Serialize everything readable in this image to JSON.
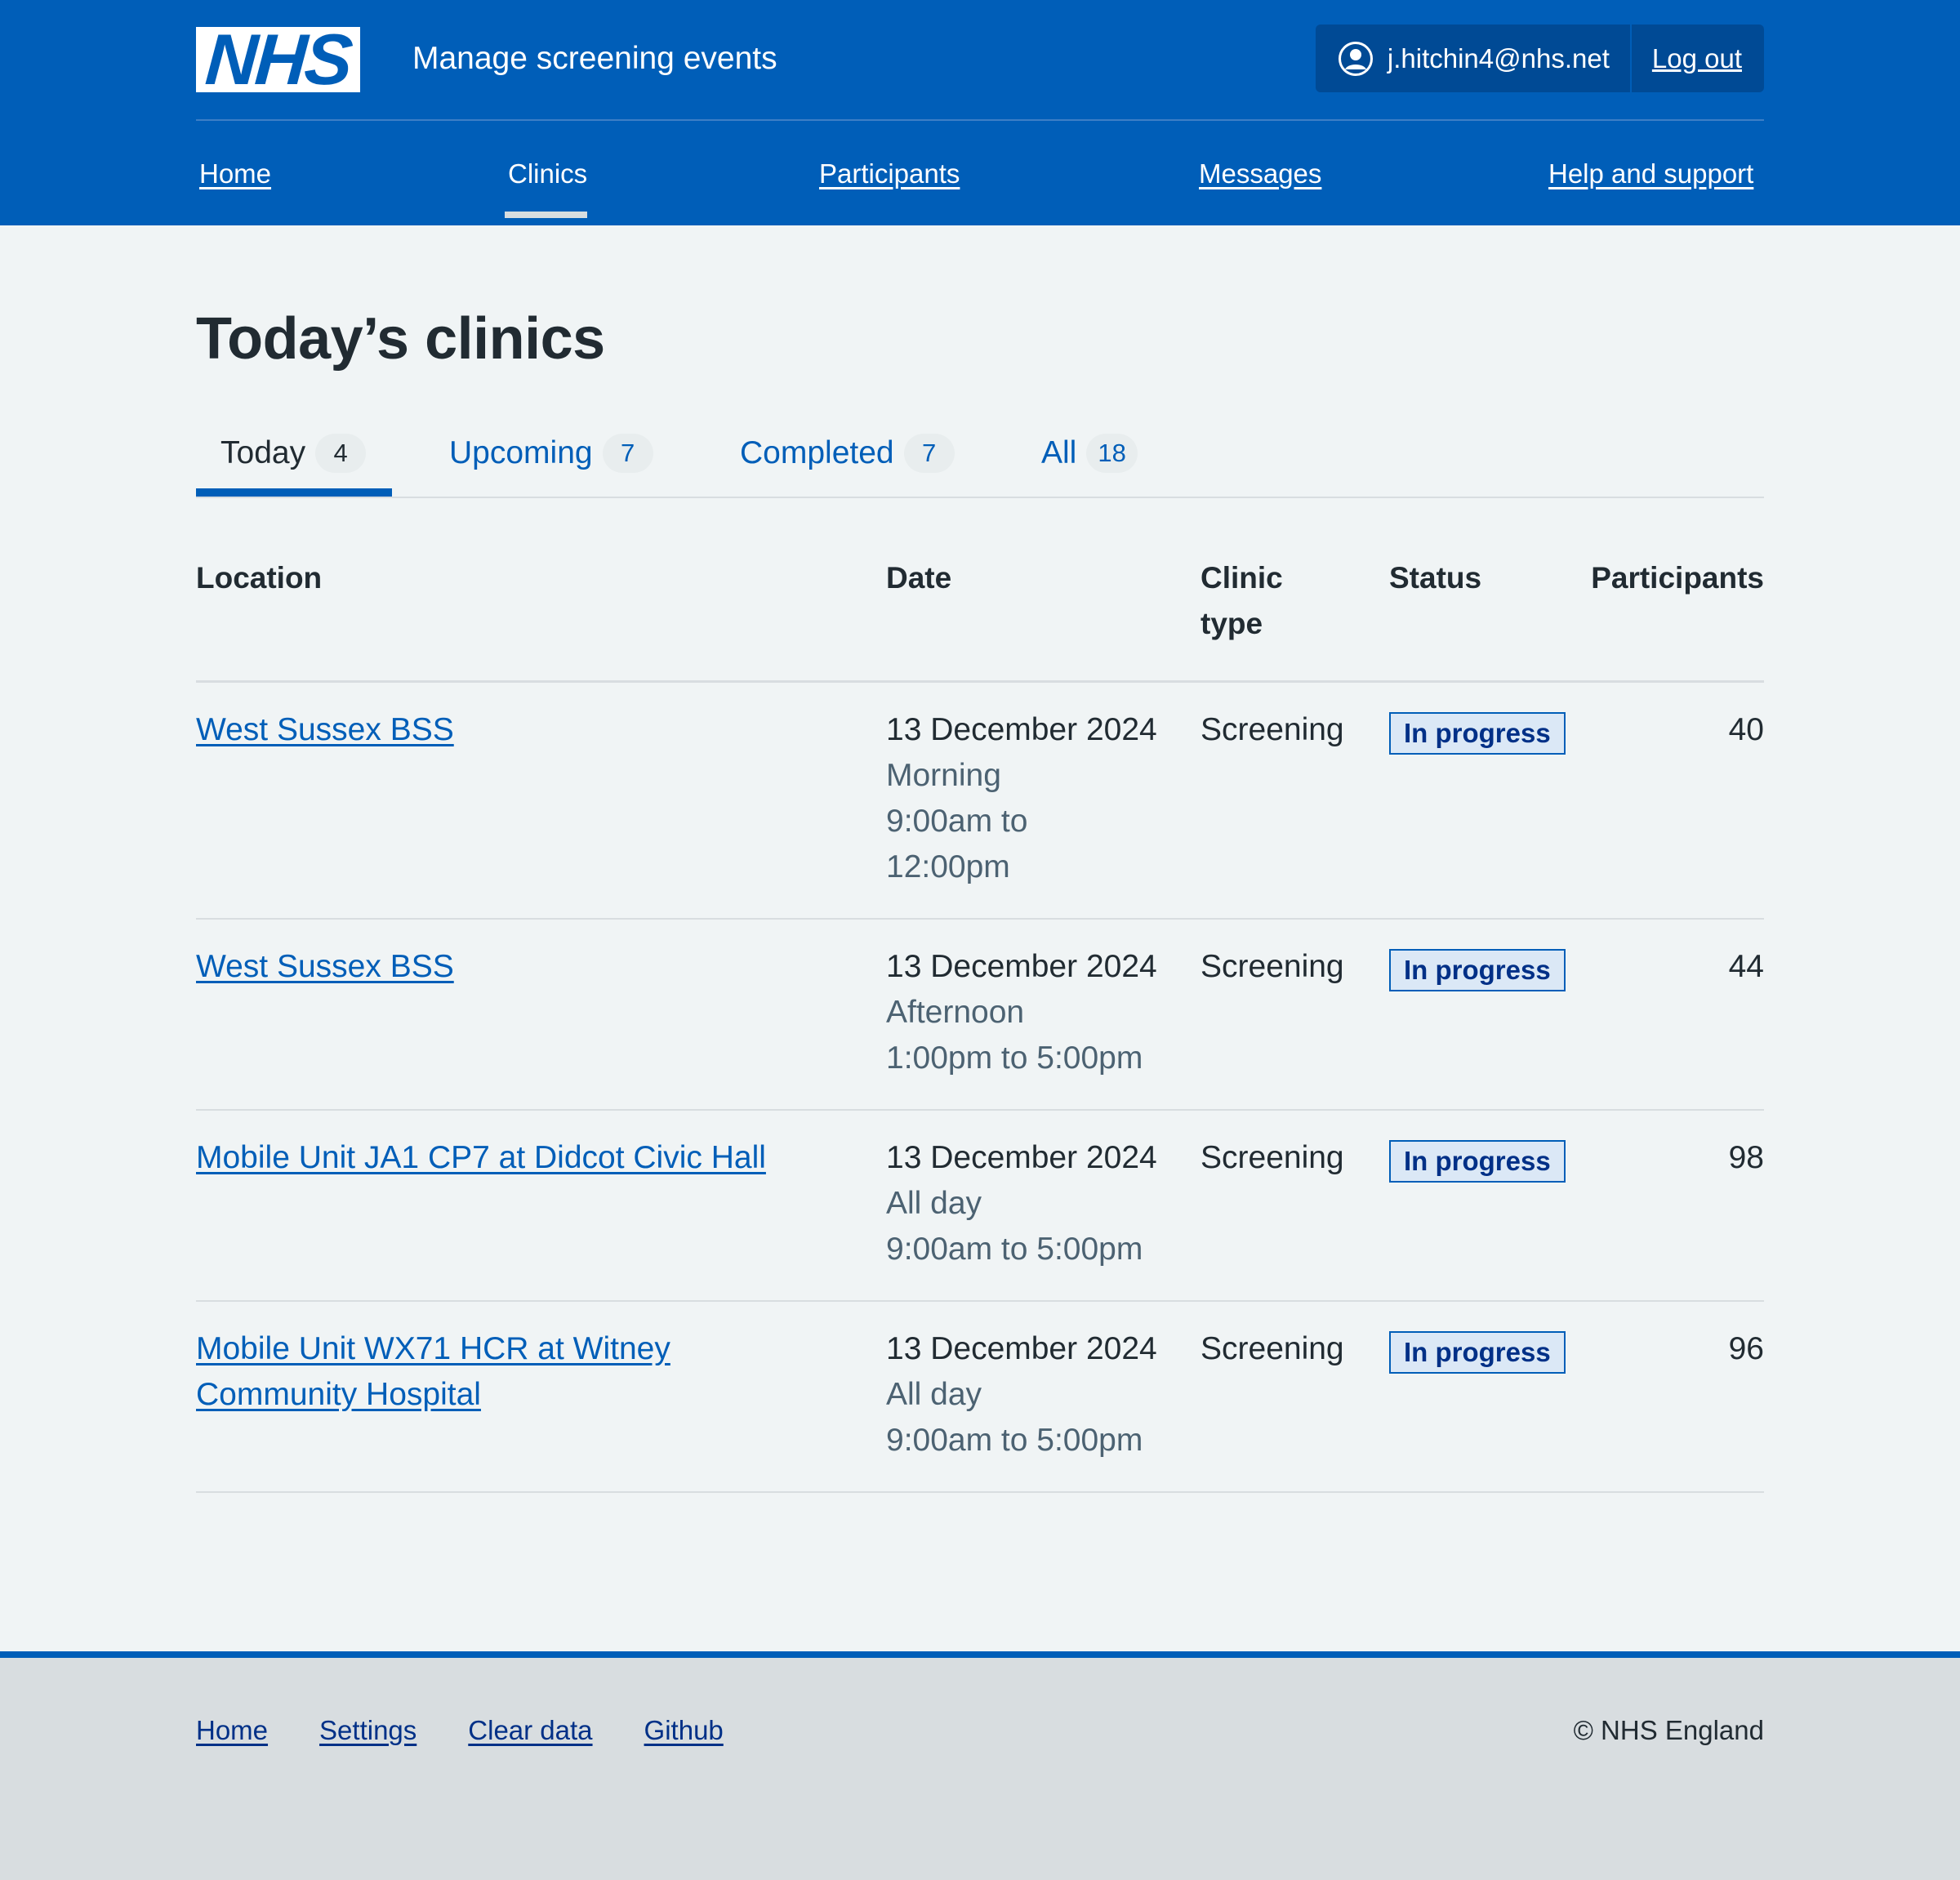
{
  "header": {
    "logo_text": "NHS",
    "service_name": "Manage screening events",
    "account_email": "j.hitchin4@nhs.net",
    "logout_label": "Log out",
    "brand_color": "#005eb8"
  },
  "nav": {
    "items": [
      {
        "label": "Home"
      },
      {
        "label": "Clinics",
        "current": true
      },
      {
        "label": "Participants"
      },
      {
        "label": "Messages"
      },
      {
        "label": "Help and support"
      }
    ]
  },
  "page": {
    "title": "Today’s clinics"
  },
  "tabs": [
    {
      "label": "Today",
      "count": "4",
      "selected": true
    },
    {
      "label": "Upcoming",
      "count": "7"
    },
    {
      "label": "Completed",
      "count": "7"
    },
    {
      "label": "All",
      "count": "18"
    }
  ],
  "table": {
    "headers": {
      "location": "Location",
      "date": "Date",
      "clinic_type_1": "Clinic",
      "clinic_type_2": "type",
      "status": "Status",
      "participants": "Participants"
    },
    "rows": [
      {
        "location_1": "West Sussex BSS",
        "location_2": "",
        "date": "13 December 2024",
        "session": "Morning",
        "time_1": "9:00am to",
        "time_2": "12:00pm",
        "clinic_type": "Screening",
        "status": "In progress",
        "participants": "40"
      },
      {
        "location_1": "West Sussex BSS",
        "location_2": "",
        "date": "13 December 2024",
        "session": "Afternoon",
        "time_1": "1:00pm to 5:00pm",
        "time_2": "",
        "clinic_type": "Screening",
        "status": "In progress",
        "participants": "44"
      },
      {
        "location_1": "Mobile Unit JA1 CP7 at Didcot Civic Hall",
        "location_2": "",
        "date": "13 December 2024",
        "session": "All day",
        "time_1": "9:00am to 5:00pm",
        "time_2": "",
        "clinic_type": "Screening",
        "status": "In progress",
        "participants": "98"
      },
      {
        "location_1": "Mobile Unit WX71 HCR at Witney",
        "location_2": "Community Hospital",
        "date": "13 December 2024",
        "session": "All day",
        "time_1": "9:00am to 5:00pm",
        "time_2": "",
        "clinic_type": "Screening",
        "status": "In progress",
        "participants": "96"
      }
    ]
  },
  "footer": {
    "links": [
      {
        "label": "Home"
      },
      {
        "label": "Settings"
      },
      {
        "label": "Clear data"
      },
      {
        "label": "Github"
      }
    ],
    "copyright": "© NHS England"
  }
}
